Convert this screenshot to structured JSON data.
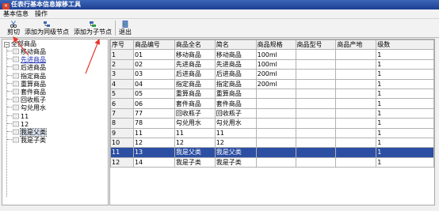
{
  "window": {
    "title": "任表行基本信息嫁移工具"
  },
  "menu": [
    "基本信息",
    "操作"
  ],
  "toolbar": {
    "cut": "剪切",
    "add_sibling": "添加为同级节点",
    "add_child": "添加为子节点",
    "exit": "退出"
  },
  "tree": {
    "root": "全部商品",
    "items": [
      "移动商品",
      "先进商品",
      "后进商品",
      "指定商品",
      "重算商品",
      "套件商品",
      "回收瓶子",
      "勾兑用水",
      "11",
      "12",
      "我是父类",
      "我是子类"
    ],
    "link_index": 1,
    "selected_index": 10
  },
  "grid": {
    "headers": [
      "序号",
      "商品编号",
      "商品全名",
      "简名",
      "商品规格",
      "商品型号",
      "商品产地",
      "级数"
    ],
    "rows": [
      [
        "1",
        "01",
        "移动商品",
        "移动商品",
        "100ml",
        "",
        "",
        "1"
      ],
      [
        "2",
        "02",
        "先进商品",
        "先进商品",
        "100ml",
        "",
        "",
        "1"
      ],
      [
        "3",
        "03",
        "后进商品",
        "后进商品",
        "200ml",
        "",
        "",
        "1"
      ],
      [
        "4",
        "04",
        "指定商品",
        "指定商品",
        "200ml",
        "",
        "",
        "1"
      ],
      [
        "5",
        "05",
        "重算商品",
        "重算商品",
        "",
        "",
        "",
        "1"
      ],
      [
        "6",
        "06",
        "套件商品",
        "套件商品",
        "",
        "",
        "",
        "1"
      ],
      [
        "7",
        "77",
        "回收瓶子",
        "回收瓶子",
        "",
        "",
        "",
        "1"
      ],
      [
        "8",
        "78",
        "勾兑用水",
        "勾兑用水",
        "",
        "",
        "",
        "1"
      ],
      [
        "9",
        "11",
        "11",
        "11",
        "",
        "",
        "",
        "1"
      ],
      [
        "10",
        "12",
        "12",
        "12",
        "",
        "",
        "",
        "1"
      ],
      [
        "11",
        "13",
        "我是父类",
        "我是父类",
        "",
        "",
        "",
        "1"
      ],
      [
        "12",
        "14",
        "我是子类",
        "我是子类",
        "",
        "",
        "",
        "1"
      ]
    ],
    "selected_row": 10
  },
  "icons": {
    "title": "app-icon",
    "cut": "cut-icon",
    "add_sibling": "add-sibling-icon",
    "add_child": "add-child-icon",
    "exit": "exit-icon",
    "folder": "folder-icon"
  },
  "colors": {
    "title_bar": "#1c3f91",
    "selection": "#2c4fa3",
    "annotation_arrow": "#e4392c"
  }
}
